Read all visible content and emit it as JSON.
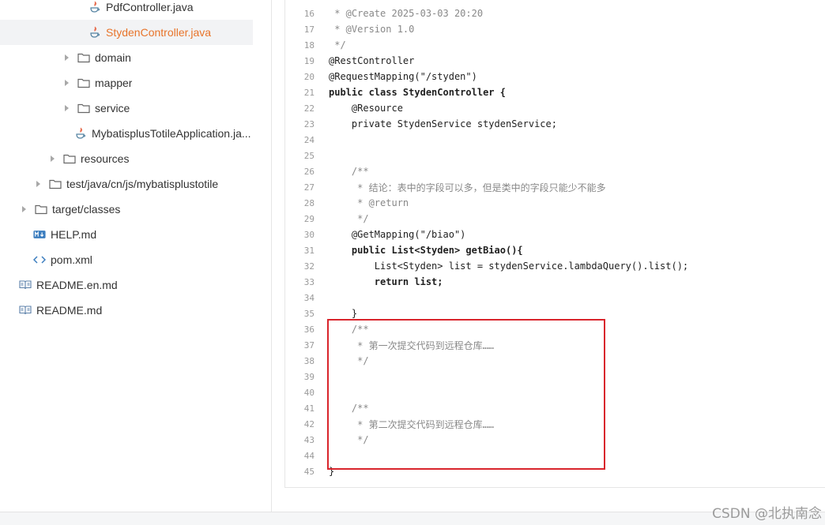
{
  "tree": {
    "items": [
      {
        "label": "PdfController.java",
        "icon": "java-icon",
        "chevron": false
      },
      {
        "label": "StydenController.java",
        "icon": "java-icon",
        "chevron": false,
        "selected": true
      },
      {
        "label": "domain",
        "icon": "folder-icon",
        "chevron": true
      },
      {
        "label": "mapper",
        "icon": "folder-icon",
        "chevron": true
      },
      {
        "label": "service",
        "icon": "folder-icon",
        "chevron": true
      },
      {
        "label": "MybatisplusTotileApplication.ja...",
        "icon": "java-icon",
        "chevron": false
      },
      {
        "label": "resources",
        "icon": "folder-icon",
        "chevron": true
      },
      {
        "label": "test/java/cn/js/mybatisplustotile",
        "icon": "folder-icon",
        "chevron": true
      },
      {
        "label": "target/classes",
        "icon": "folder-icon",
        "chevron": true
      },
      {
        "label": "HELP.md",
        "icon": "markdown-icon",
        "chevron": false
      },
      {
        "label": "pom.xml",
        "icon": "code-icon",
        "chevron": false
      },
      {
        "label": "README.en.md",
        "icon": "readme-icon",
        "chevron": false
      },
      {
        "label": "README.md",
        "icon": "readme-icon",
        "chevron": false
      }
    ]
  },
  "code": {
    "lines": [
      {
        "n": "16",
        "t": " * @Create 2025-03-03 20:20"
      },
      {
        "n": "17",
        "t": " * @Version 1.0"
      },
      {
        "n": "18",
        "t": " */"
      },
      {
        "n": "19",
        "t": "@RestController"
      },
      {
        "n": "20",
        "t": "@RequestMapping(\"/styden\")"
      },
      {
        "n": "21",
        "t": "public class StydenController {"
      },
      {
        "n": "22",
        "t": "    @Resource"
      },
      {
        "n": "23",
        "t": "    private StydenService stydenService;"
      },
      {
        "n": "24",
        "t": ""
      },
      {
        "n": "25",
        "t": ""
      },
      {
        "n": "26",
        "t": "    /**"
      },
      {
        "n": "27",
        "t": "     * 结论：表中的字段可以多，但是类中的字段只能少不能多"
      },
      {
        "n": "28",
        "t": "     * @return"
      },
      {
        "n": "29",
        "t": "     */"
      },
      {
        "n": "30",
        "t": "    @GetMapping(\"/biao\")"
      },
      {
        "n": "31",
        "t": "    public List<Styden> getBiao(){"
      },
      {
        "n": "32",
        "t": "        List<Styden> list = stydenService.lambdaQuery().list();"
      },
      {
        "n": "33",
        "t": "        return list;"
      },
      {
        "n": "34",
        "t": ""
      },
      {
        "n": "35",
        "t": "    }"
      },
      {
        "n": "36",
        "t": "    /**"
      },
      {
        "n": "37",
        "t": "     * 第一次提交代码到远程仓库……"
      },
      {
        "n": "38",
        "t": "     */"
      },
      {
        "n": "39",
        "t": ""
      },
      {
        "n": "40",
        "t": ""
      },
      {
        "n": "41",
        "t": "    /**"
      },
      {
        "n": "42",
        "t": "     * 第二次提交代码到远程仓库……"
      },
      {
        "n": "43",
        "t": "     */"
      },
      {
        "n": "44",
        "t": ""
      },
      {
        "n": "45",
        "t": "}"
      }
    ]
  },
  "watermark": "CSDN @北执南念",
  "colors": {
    "selected_text": "#e8742a",
    "highlight_border": "#d9252c"
  }
}
